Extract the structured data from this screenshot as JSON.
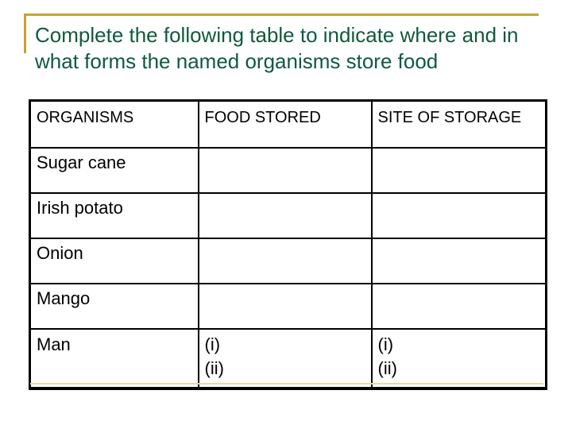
{
  "title": "Complete the following table to indicate where and in what forms the named organisms store food",
  "colors": {
    "title_text": "#0f5a3c",
    "accent": "#c8a232",
    "table_border": "#000000"
  },
  "table": {
    "headers": [
      "ORGANISMS",
      "FOOD STORED",
      "SITE OF STORAGE"
    ],
    "rows": [
      {
        "organism": "Sugar cane",
        "food_stored": "",
        "site_of_storage": ""
      },
      {
        "organism": "Irish potato",
        "food_stored": "",
        "site_of_storage": ""
      },
      {
        "organism": "Onion",
        "food_stored": "",
        "site_of_storage": ""
      },
      {
        "organism": "Mango",
        "food_stored": "",
        "site_of_storage": ""
      },
      {
        "organism": "Man",
        "food_stored": [
          "(i)",
          "(ii)"
        ],
        "site_of_storage": [
          "(i)",
          "(ii)"
        ]
      }
    ]
  }
}
